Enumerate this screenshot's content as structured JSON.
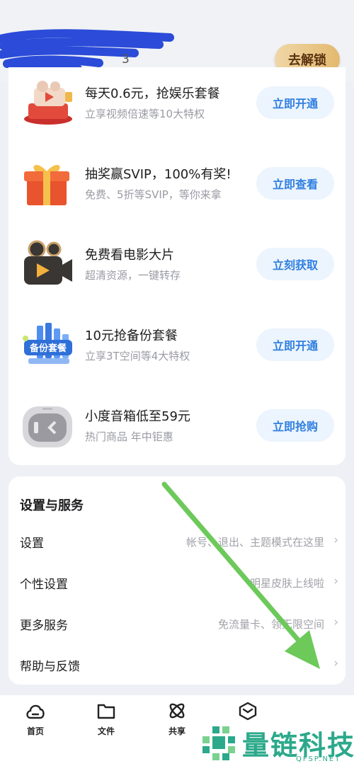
{
  "header": {
    "title_fragment": "3",
    "unlock_label": "去解锁"
  },
  "promos": [
    {
      "title": "每天0.6元，抢娱乐套餐",
      "subtitle": "立享视频倍速等10大特权",
      "button": "立即开通",
      "icon": "video-package-icon"
    },
    {
      "title": "抽奖赢SVIP，100%有奖!",
      "subtitle": "免费、5折等SVIP，等你来拿",
      "button": "立即查看",
      "icon": "gift-box-icon"
    },
    {
      "title": "免费看电影大片",
      "subtitle": "超清资源，一键转存",
      "button": "立刻获取",
      "icon": "movie-camera-icon"
    },
    {
      "title": "10元抢备份套餐",
      "subtitle": "立享3T空间等4大特权",
      "button": "立即开通",
      "icon": "backup-package-icon",
      "badge": "备份套餐"
    },
    {
      "title": "小度音箱低至59元",
      "subtitle": "热门商品 年中钜惠",
      "button": "立即抢购",
      "icon": "speaker-icon"
    }
  ],
  "settings": {
    "title": "设置与服务",
    "rows": [
      {
        "label": "设置",
        "desc": "帐号、退出、主题模式在这里"
      },
      {
        "label": "个性设置",
        "desc": "明星皮肤上线啦"
      },
      {
        "label": "更多服务",
        "desc": "免流量卡、领无限空间"
      },
      {
        "label": "帮助与反馈",
        "desc": ""
      }
    ]
  },
  "nav": [
    {
      "label": "首页",
      "icon": "home-cloud-icon"
    },
    {
      "label": "文件",
      "icon": "folder-icon"
    },
    {
      "label": "共享",
      "icon": "share-atom-icon"
    },
    {
      "label": "",
      "icon": "box-icon"
    }
  ],
  "watermark": {
    "text": "量链科技",
    "sub": "QFSP.NET"
  },
  "colors": {
    "accent": "#2f7fe0",
    "button_bg": "#ecf4fd",
    "gold": "#e3b96f",
    "annotation_arrow": "#6cc95a",
    "watermark": "#2ba98a"
  }
}
